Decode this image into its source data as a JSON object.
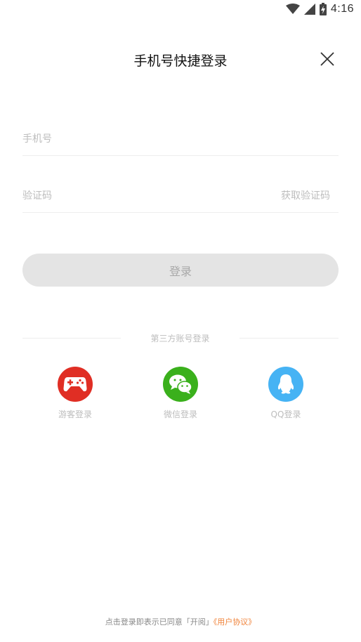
{
  "status_bar": {
    "time": "4:16",
    "icons": [
      "wifi-icon",
      "signal-icon",
      "battery-charging-icon"
    ]
  },
  "header": {
    "title": "手机号快捷登录",
    "close_icon": "close-icon"
  },
  "form": {
    "phone_placeholder": "手机号",
    "code_placeholder": "验证码",
    "get_code_label": "获取验证码",
    "login_label": "登录"
  },
  "third_party": {
    "divider_text": "第三方账号登录",
    "options": [
      {
        "label": "游客登录",
        "icon": "gamepad-icon",
        "color": "#e02e24"
      },
      {
        "label": "微信登录",
        "icon": "wechat-icon",
        "color": "#3ab01c"
      },
      {
        "label": "QQ登录",
        "icon": "qq-penguin-icon",
        "color": "#46b3f4"
      }
    ]
  },
  "footer": {
    "text": "点击登录即表示已同意「开阅」",
    "link": "《用户协议》",
    "link_color": "#f0833a"
  }
}
